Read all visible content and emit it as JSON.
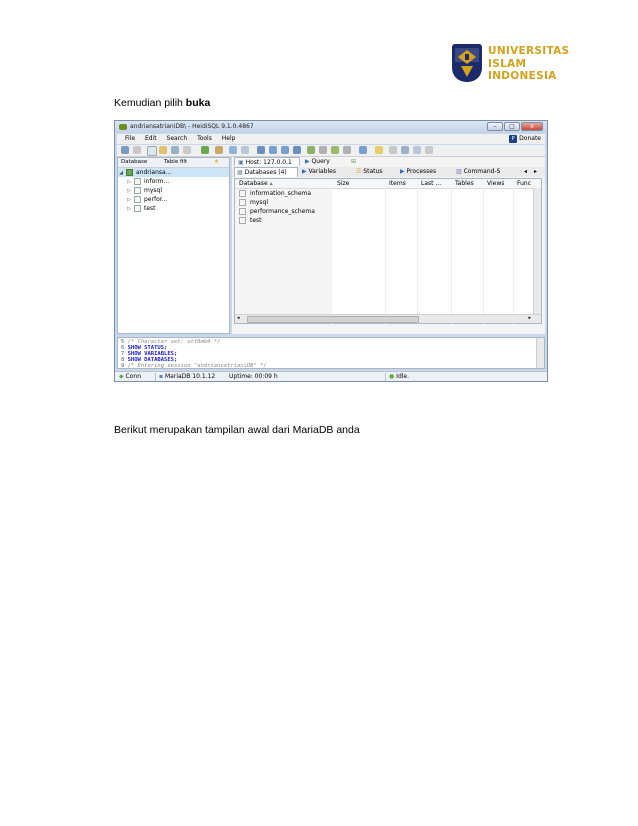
{
  "logo": {
    "line1": "UNIVERSITAS",
    "line2": "ISLAM",
    "line3": "INDONESIA",
    "color": "#d4a21a",
    "emblem_color": "#1b2a6b"
  },
  "intro": {
    "text": "Kemudian pilih ",
    "bold": "buka"
  },
  "heidisql": {
    "title": "andriansatrianiDB\\ - HeidiSQL 9.1.0.4867",
    "window_buttons": [
      "–",
      "□",
      "x"
    ],
    "menu": [
      "File",
      "Edit",
      "Search",
      "Tools",
      "Help"
    ],
    "donate": "Donate",
    "left_tabs": [
      "Database",
      "Table filt"
    ],
    "tree": [
      {
        "label": "andriansa..."
      },
      {
        "label": "inform..."
      },
      {
        "label": "mysql"
      },
      {
        "label": "perfor..."
      },
      {
        "label": "test"
      }
    ],
    "host_tab": "Host: 127.0.0.1",
    "query_tab": "Query",
    "sub_tabs": [
      "Databases (4)",
      "Variables",
      "Status",
      "Processes",
      "Command-S"
    ],
    "columns": [
      "Database",
      "Size",
      "Items",
      "Last ...",
      "Tables",
      "Views",
      "Func"
    ],
    "databases": [
      "information_schema",
      "mysql",
      "performance_schema",
      "test"
    ],
    "log": [
      {
        "num": "5",
        "text": "/* Character set: utf8mb4 */",
        "type": "comment"
      },
      {
        "num": "6",
        "text": "SHOW STATUS;",
        "type": "keyword"
      },
      {
        "num": "7",
        "text": "SHOW VARIABLES;",
        "type": "keyword"
      },
      {
        "num": "8",
        "text": "SHOW DATABASES;",
        "type": "keyword"
      },
      {
        "num": "9",
        "text": "/* Entering session \"andriansatrianiDB\" */",
        "type": "comment"
      }
    ],
    "status": {
      "conn": "Conn",
      "server": "MariaDB 10.1.12",
      "uptime": "Uptime: 00:09 h",
      "state": "Idle."
    }
  },
  "outro": {
    "text": "Berikut merupakan tampilan awal dari MariaDB anda"
  }
}
